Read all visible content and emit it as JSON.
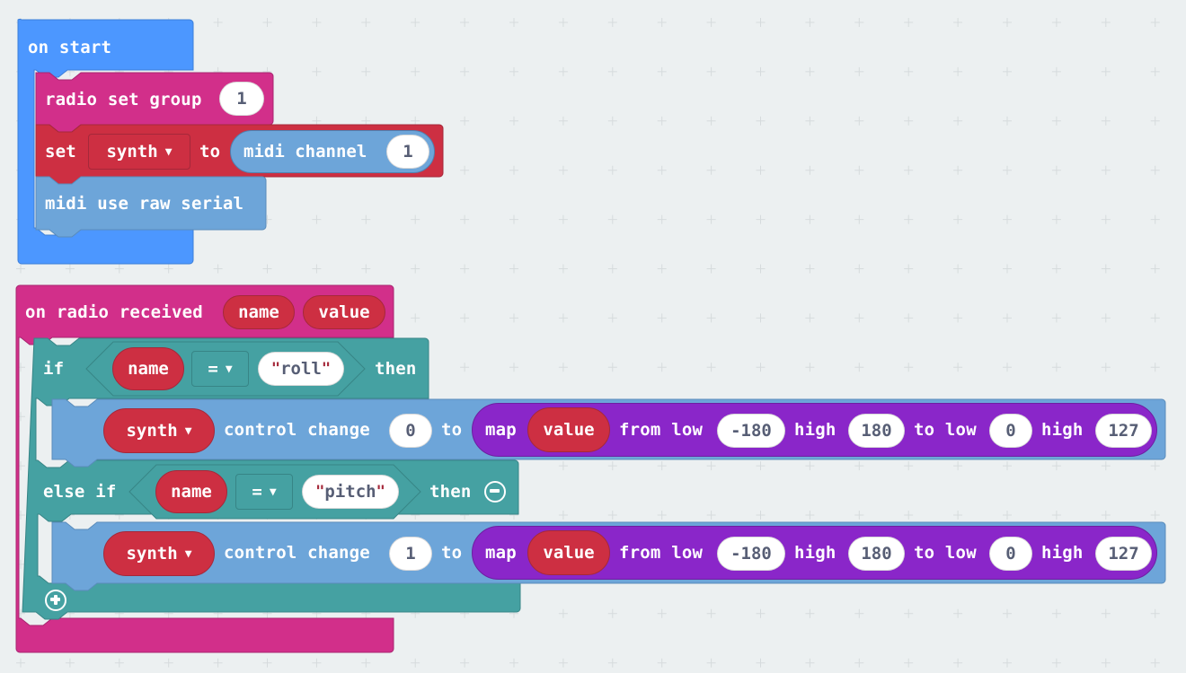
{
  "colors": {
    "background": "#ecf0f1",
    "basic": "#4c97ff",
    "radio": "#d22f8a",
    "variables": "#cd2f42",
    "logic": "#45a1a2",
    "midi": "#6da5d9",
    "math": "#8a26c9",
    "value_pill": "#ffffff"
  },
  "on_start": {
    "label": "on start",
    "radio_set_group": {
      "label": "radio set group",
      "value": "1"
    },
    "set_var": {
      "set_label": "set",
      "variable": "synth",
      "to_label": "to",
      "midi_channel": {
        "label": "midi channel",
        "value": "1"
      }
    },
    "midi_use_raw_serial": {
      "label": "midi use raw serial"
    }
  },
  "on_radio_received": {
    "label": "on radio received",
    "params": [
      "name",
      "value"
    ],
    "if_block": {
      "if_label": "if",
      "then_label": "then",
      "else_if_label": "else if",
      "branches": [
        {
          "condition": {
            "left": "name",
            "operator": "=",
            "right": "roll"
          },
          "statement": {
            "variable": "synth",
            "label": "control change",
            "control": "0",
            "to_label": "to",
            "map": {
              "label": "map",
              "value": "value",
              "from_low_label": "from low",
              "from_low": "-180",
              "high_label": "high",
              "from_high": "180",
              "to_low_label": "to low",
              "to_low": "0",
              "high2_label": "high",
              "to_high": "127"
            }
          }
        },
        {
          "condition": {
            "left": "name",
            "operator": "=",
            "right": "pitch"
          },
          "statement": {
            "variable": "synth",
            "label": "control change",
            "control": "1",
            "to_label": "to",
            "map": {
              "label": "map",
              "value": "value",
              "from_low_label": "from low",
              "from_low": "-180",
              "high_label": "high",
              "from_high": "180",
              "to_low_label": "to low",
              "to_low": "0",
              "high2_label": "high",
              "to_high": "127"
            }
          }
        }
      ]
    }
  },
  "quote_char": "\""
}
